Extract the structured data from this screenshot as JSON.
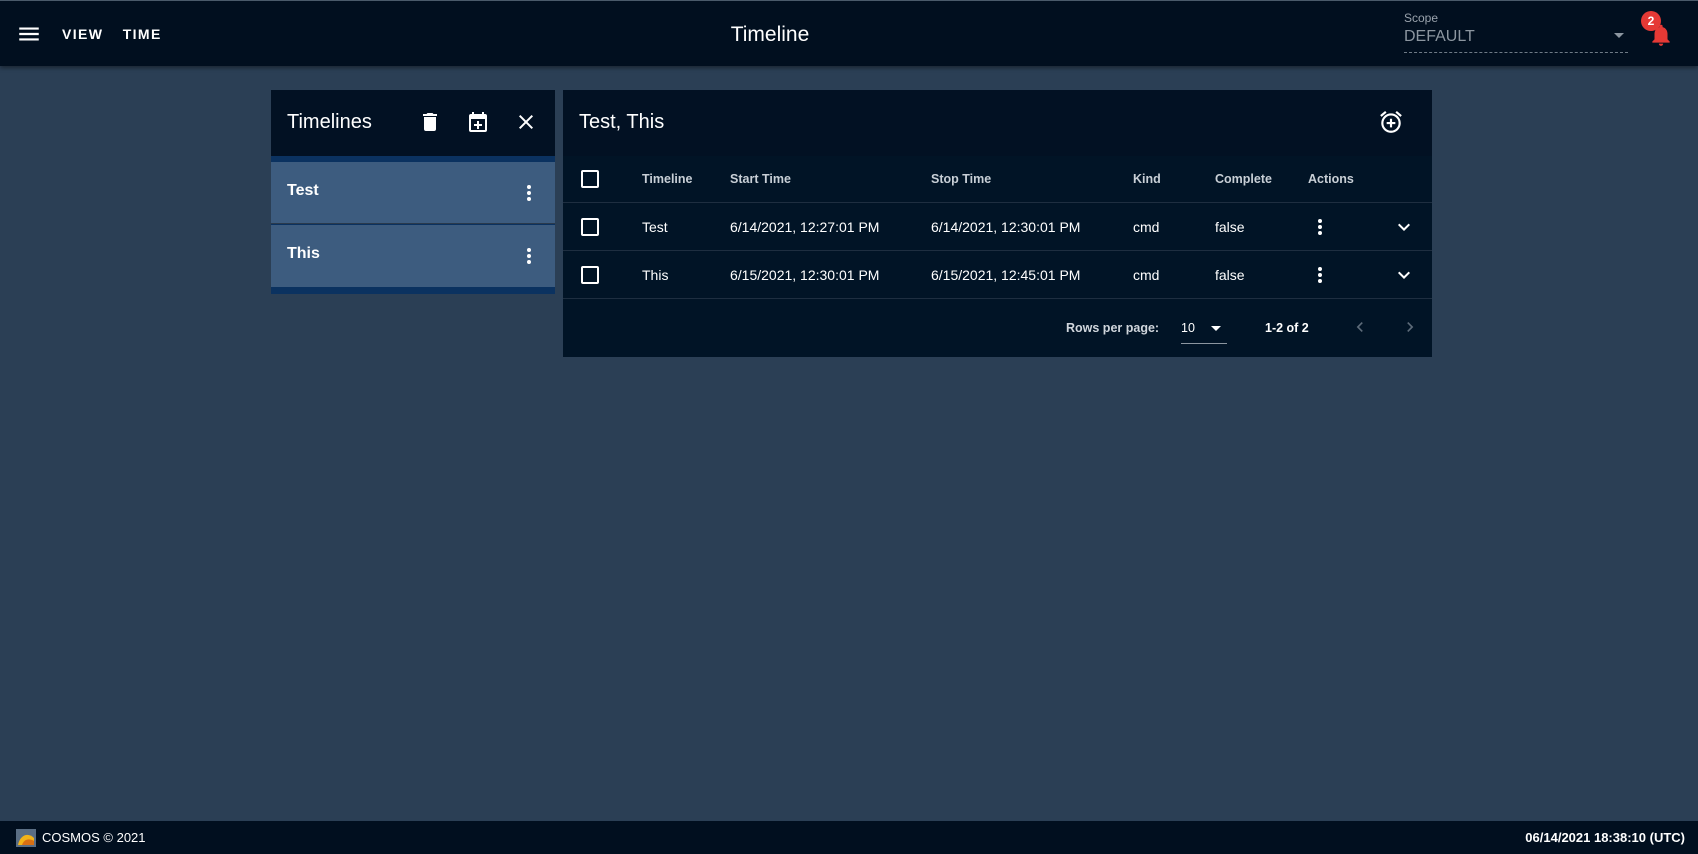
{
  "appbar": {
    "menu_items": [
      "View",
      "Time"
    ],
    "title": "Timeline",
    "scope_label": "Scope",
    "scope_value": "DEFAULT",
    "notification_count": "2"
  },
  "timelines": {
    "title": "Timelines",
    "items": [
      {
        "label": "Test"
      },
      {
        "label": "This"
      }
    ]
  },
  "events": {
    "title": "Test, This",
    "columns": [
      "Timeline",
      "Start Time",
      "Stop Time",
      "Kind",
      "Complete",
      "Actions"
    ],
    "rows": [
      {
        "timeline": "Test",
        "start": "6/14/2021, 12:27:01 PM",
        "stop": "6/14/2021, 12:30:01 PM",
        "kind": "cmd",
        "complete": "false"
      },
      {
        "timeline": "This",
        "start": "6/15/2021, 12:30:01 PM",
        "stop": "6/15/2021, 12:45:01 PM",
        "kind": "cmd",
        "complete": "false"
      }
    ],
    "footer": {
      "rows_per_page_label": "Rows per page:",
      "rows_per_page": "10",
      "page_info": "1-2 of 2"
    }
  },
  "footer": {
    "copyright": "COSMOS © 2021",
    "clock": "06/14/2021 18:38:10 (UTC)"
  },
  "colors": {
    "background": "#2b3f55",
    "appbar": "#010f1f",
    "panel": "#011426",
    "list_item": "#3d5c7f",
    "badge": "#e53935"
  }
}
